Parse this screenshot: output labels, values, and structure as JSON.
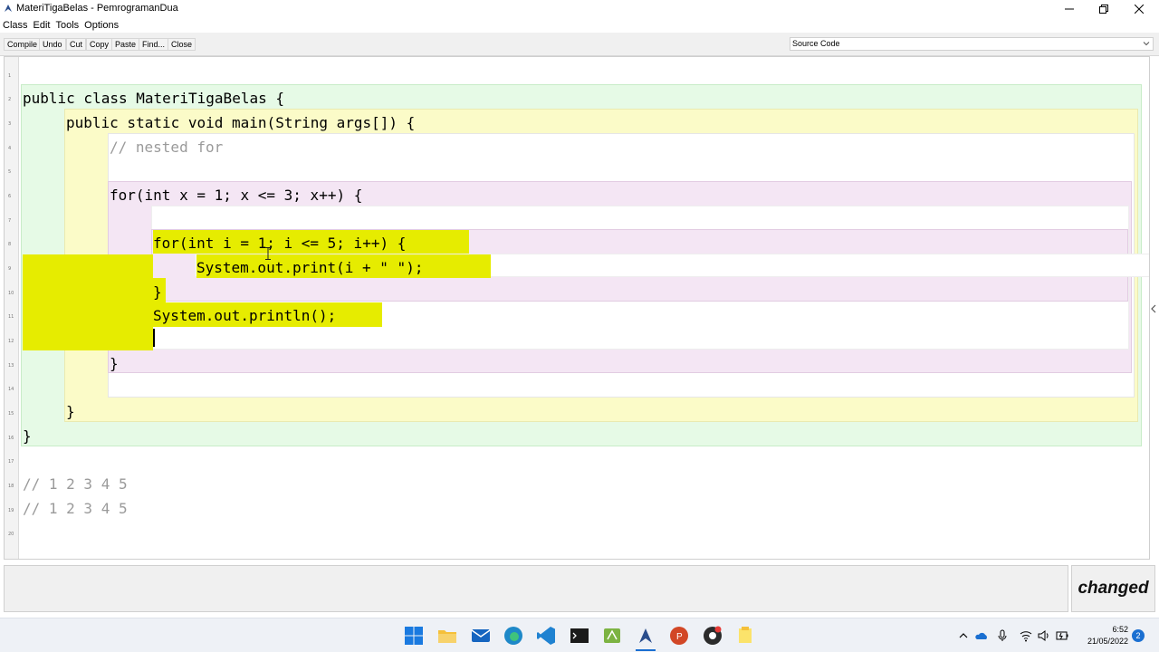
{
  "window": {
    "title": "MateriTigaBelas - PemrogramanDua"
  },
  "menu": [
    "Class",
    "Edit",
    "Tools",
    "Options"
  ],
  "toolbar": {
    "buttons": [
      "Compile",
      "Undo",
      "Cut",
      "Copy",
      "Paste",
      "Find...",
      "Close"
    ],
    "view_select": "Source Code"
  },
  "editor": {
    "line_numbers": [
      "1",
      "2",
      "3",
      "4",
      "5",
      "6",
      "7",
      "8",
      "9",
      "10",
      "11",
      "12",
      "13",
      "14",
      "15",
      "16",
      "17",
      "18",
      "19",
      "20"
    ],
    "lines": [
      "public class MateriTigaBelas {",
      "public static void main(String args[]) {",
      "// nested for",
      "for(int x = 1; x <= 3; x++) {",
      "for(int i = 1; i <= 5; i++) {",
      "System.out.print(i + \" \");",
      "}",
      "System.out.println();",
      "}",
      "}",
      "}",
      "// 1 2 3 4 5",
      "// 1 2 3 4 5"
    ]
  },
  "status": {
    "message": "",
    "changed_label": "changed"
  },
  "taskbar": {
    "time": "6:52",
    "date": "21/05/2022",
    "notification_count": "2"
  },
  "colors": {
    "class_scope": "#e6fae6",
    "method_scope": "#fbfbc8",
    "loop_scope": "#f4e6f4",
    "selection": "#e6ec00"
  }
}
